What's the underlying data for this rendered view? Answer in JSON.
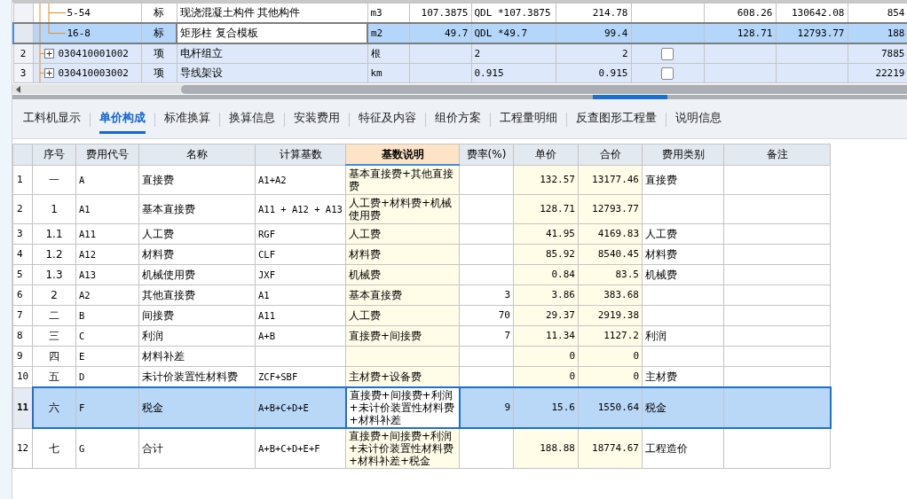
{
  "top_grid": {
    "rows": [
      {
        "kind": "sub",
        "row_number": null,
        "selected": false,
        "cells": [
          "5-54",
          "标",
          "现浇混凝土构件 其他构件",
          "m3",
          "107.3875",
          "QDL *107.3875",
          "214.78",
          null,
          "608.26",
          "130642.08",
          "854"
        ]
      },
      {
        "kind": "sub",
        "row_number": null,
        "selected": true,
        "cells": [
          "16-8",
          "标",
          "矩形柱 复合模板",
          "m2",
          "49.7",
          "QDL *49.7",
          "99.4",
          null,
          "128.71",
          "12793.77",
          "188"
        ]
      },
      {
        "kind": "group",
        "row_number": "2",
        "selected": false,
        "expanded": false,
        "checked": false,
        "cells": [
          "030410001002",
          "项",
          "电杆组立",
          "根",
          null,
          "2",
          "2",
          null,
          null,
          null,
          "7885"
        ]
      },
      {
        "kind": "group",
        "row_number": "3",
        "selected": false,
        "expanded": false,
        "checked": false,
        "cells": [
          "030410003002",
          "项",
          "导线架设",
          "km",
          null,
          "0.915",
          "0.915",
          null,
          null,
          null,
          "22219"
        ]
      }
    ]
  },
  "tabs": [
    {
      "label": "工料机显示",
      "selected": false
    },
    {
      "label": "单价构成",
      "selected": true
    },
    {
      "label": "标准换算",
      "selected": false
    },
    {
      "label": "换算信息",
      "selected": false
    },
    {
      "label": "安装费用",
      "selected": false
    },
    {
      "label": "特征及内容",
      "selected": false
    },
    {
      "label": "组价方案",
      "selected": false
    },
    {
      "label": "工程量明细",
      "selected": false
    },
    {
      "label": "反查图形工程量",
      "selected": false
    },
    {
      "label": "说明信息",
      "selected": false
    }
  ],
  "cost_table": {
    "columns": [
      {
        "label": "序号",
        "kind": "center",
        "readonly": false,
        "selected": false
      },
      {
        "label": "费用代号",
        "kind": "code",
        "readonly": false,
        "selected": false
      },
      {
        "label": "名称",
        "kind": "text",
        "readonly": false,
        "selected": false
      },
      {
        "label": "计算基数",
        "kind": "code",
        "readonly": false,
        "selected": false
      },
      {
        "label": "基数说明",
        "kind": "text",
        "readonly": true,
        "selected": true
      },
      {
        "label": "费率(%)",
        "kind": "number",
        "readonly": false,
        "selected": false
      },
      {
        "label": "单价",
        "kind": "number",
        "readonly": true,
        "selected": false
      },
      {
        "label": "合价",
        "kind": "number",
        "readonly": true,
        "selected": false
      },
      {
        "label": "费用类别",
        "kind": "text",
        "readonly": false,
        "selected": false
      },
      {
        "label": "备注",
        "kind": "text",
        "readonly": false,
        "selected": false
      }
    ],
    "rows": [
      {
        "row_number": "1",
        "selected": false,
        "cells": [
          "一",
          "A",
          "直接费",
          "A1+A2",
          "基本直接费+其他直接费",
          null,
          "132.57",
          "13177.46",
          "直接费",
          null
        ]
      },
      {
        "row_number": "2",
        "selected": false,
        "cells": [
          "1",
          "A1",
          "基本直接费",
          "A11 + A12 + A13",
          "人工费+材料费+机械使用费",
          null,
          "128.71",
          "12793.77",
          null,
          null
        ]
      },
      {
        "row_number": "3",
        "selected": false,
        "cells": [
          "1.1",
          "A11",
          "人工费",
          "RGF",
          "人工费",
          null,
          "41.95",
          "4169.83",
          "人工费",
          null
        ]
      },
      {
        "row_number": "4",
        "selected": false,
        "cells": [
          "1.2",
          "A12",
          "材料费",
          "CLF",
          "材料费",
          null,
          "85.92",
          "8540.45",
          "材料费",
          null
        ]
      },
      {
        "row_number": "5",
        "selected": false,
        "cells": [
          "1.3",
          "A13",
          "机械使用费",
          "JXF",
          "机械费",
          null,
          "0.84",
          "83.5",
          "机械费",
          null
        ]
      },
      {
        "row_number": "6",
        "selected": false,
        "cells": [
          "2",
          "A2",
          "其他直接费",
          "A1",
          "基本直接费",
          "3",
          "3.86",
          "383.68",
          null,
          null
        ]
      },
      {
        "row_number": "7",
        "selected": false,
        "cells": [
          "二",
          "B",
          "间接费",
          "A11",
          "人工费",
          "70",
          "29.37",
          "2919.38",
          null,
          null
        ]
      },
      {
        "row_number": "8",
        "selected": false,
        "cells": [
          "三",
          "C",
          "利润",
          "A+B",
          "直接费+间接费",
          "7",
          "11.34",
          "1127.2",
          "利润",
          null
        ]
      },
      {
        "row_number": "9",
        "selected": false,
        "cells": [
          "四",
          "E",
          "材料补差",
          null,
          null,
          null,
          "0",
          "0",
          null,
          null
        ]
      },
      {
        "row_number": "10",
        "selected": false,
        "cells": [
          "五",
          "D",
          "未计价装置性材料费",
          "ZCF+SBF",
          "主材费+设备费",
          null,
          "0",
          "0",
          "主材费",
          null
        ]
      },
      {
        "row_number": "11",
        "selected": true,
        "cells": [
          "六",
          "F",
          "税金",
          "A+B+C+D+E",
          "直接费+间接费+利润+未计价装置性材料费+材料补差",
          "9",
          "15.6",
          "1550.64",
          "税金",
          null
        ]
      },
      {
        "row_number": "12",
        "selected": false,
        "cells": [
          "七",
          "G",
          "合计",
          "A+B+C+D+E+F",
          "直接费+间接费+利润+未计价装置性材料费+材料补差+税金",
          null,
          "188.88",
          "18774.67",
          "工程造价",
          null
        ]
      }
    ]
  }
}
